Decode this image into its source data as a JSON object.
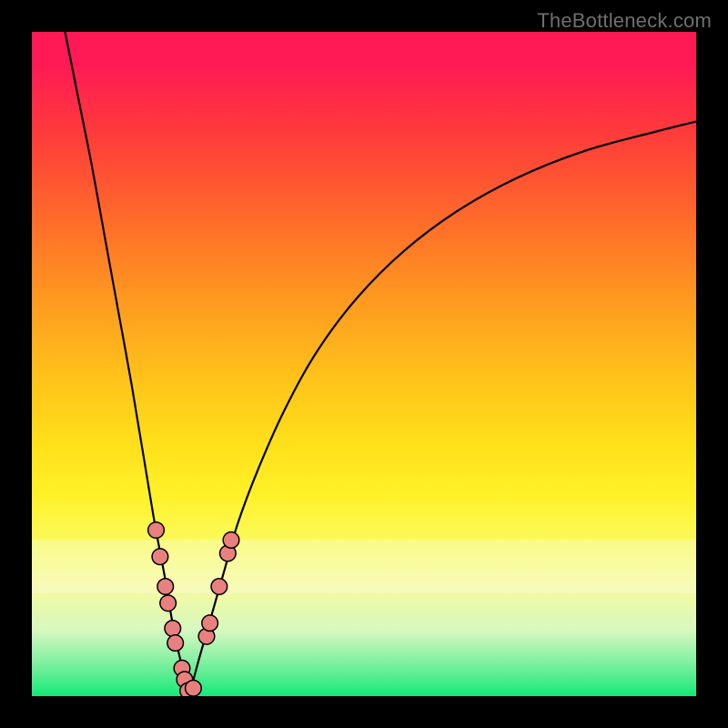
{
  "watermark": "TheBottleneck.com",
  "chart_data": {
    "type": "line",
    "title": "",
    "xlabel": "",
    "ylabel": "",
    "xlim": [
      0,
      100
    ],
    "ylim": [
      0,
      100
    ],
    "series": [
      {
        "name": "left-branch",
        "x": [
          5,
          7,
          9,
          11,
          13,
          15,
          17,
          18.5,
          20,
          21,
          22,
          23,
          23.7
        ],
        "y": [
          100,
          90,
          80,
          69,
          58,
          47,
          35,
          26,
          18,
          12,
          7,
          3,
          0
        ]
      },
      {
        "name": "right-branch",
        "x": [
          23.7,
          25,
          27,
          29,
          31,
          34,
          38,
          43,
          49,
          56,
          64,
          73,
          83,
          94,
          100
        ],
        "y": [
          0,
          5,
          12,
          19,
          26,
          34,
          43,
          52,
          60,
          67,
          73,
          78,
          82,
          85,
          86.5
        ]
      }
    ],
    "markers": [
      {
        "x": 18.7,
        "y": 25
      },
      {
        "x": 19.3,
        "y": 21
      },
      {
        "x": 20.1,
        "y": 16.5
      },
      {
        "x": 20.5,
        "y": 14
      },
      {
        "x": 21.2,
        "y": 10.2
      },
      {
        "x": 21.6,
        "y": 8.0
      },
      {
        "x": 22.6,
        "y": 4.2
      },
      {
        "x": 23.0,
        "y": 2.5
      },
      {
        "x": 23.5,
        "y": 0.8
      },
      {
        "x": 24.3,
        "y": 1.2
      },
      {
        "x": 26.3,
        "y": 9.0
      },
      {
        "x": 26.8,
        "y": 11.0
      },
      {
        "x": 28.2,
        "y": 16.5
      },
      {
        "x": 29.5,
        "y": 21.5
      },
      {
        "x": 30.0,
        "y": 23.5
      }
    ],
    "colors": {
      "curve": "#000000",
      "marker_fill": "#e98080",
      "marker_stroke": "#000000"
    }
  }
}
